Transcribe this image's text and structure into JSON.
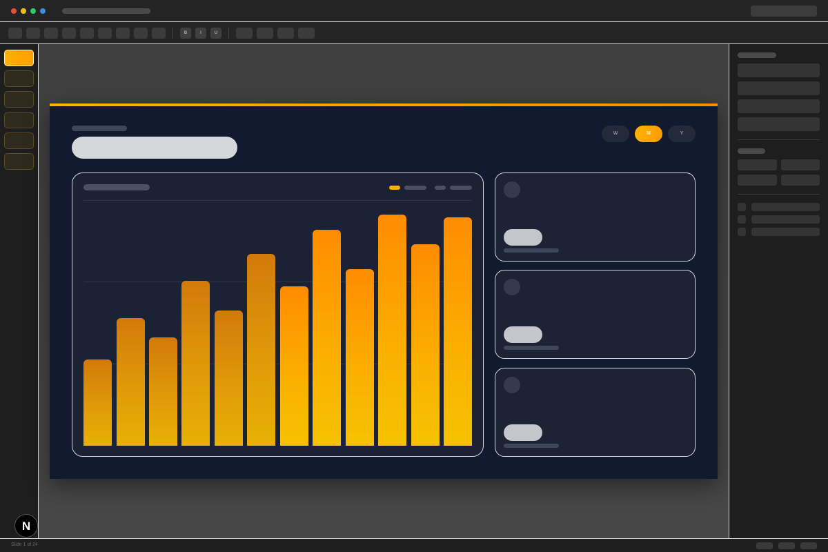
{
  "toolbar": {
    "bold_label": "B",
    "italic_label": "I",
    "underline_label": "U"
  },
  "slide": {
    "period_toggle": {
      "options": [
        "W",
        "M",
        "Y"
      ],
      "selected": "M"
    }
  },
  "chart_data": {
    "type": "bar",
    "values": [
      125,
      185,
      157,
      239,
      196,
      278,
      231,
      313,
      256,
      335,
      292,
      331
    ],
    "ylim": [
      0,
      355
    ],
    "grid": true
  },
  "status": {
    "slide_counter": "Slide 1 of 24"
  },
  "badge": {
    "letter": "N"
  },
  "colors": {
    "accent": "#ffa500",
    "slide_bg": "#111a2e",
    "card_border": "#d8dbe2"
  }
}
